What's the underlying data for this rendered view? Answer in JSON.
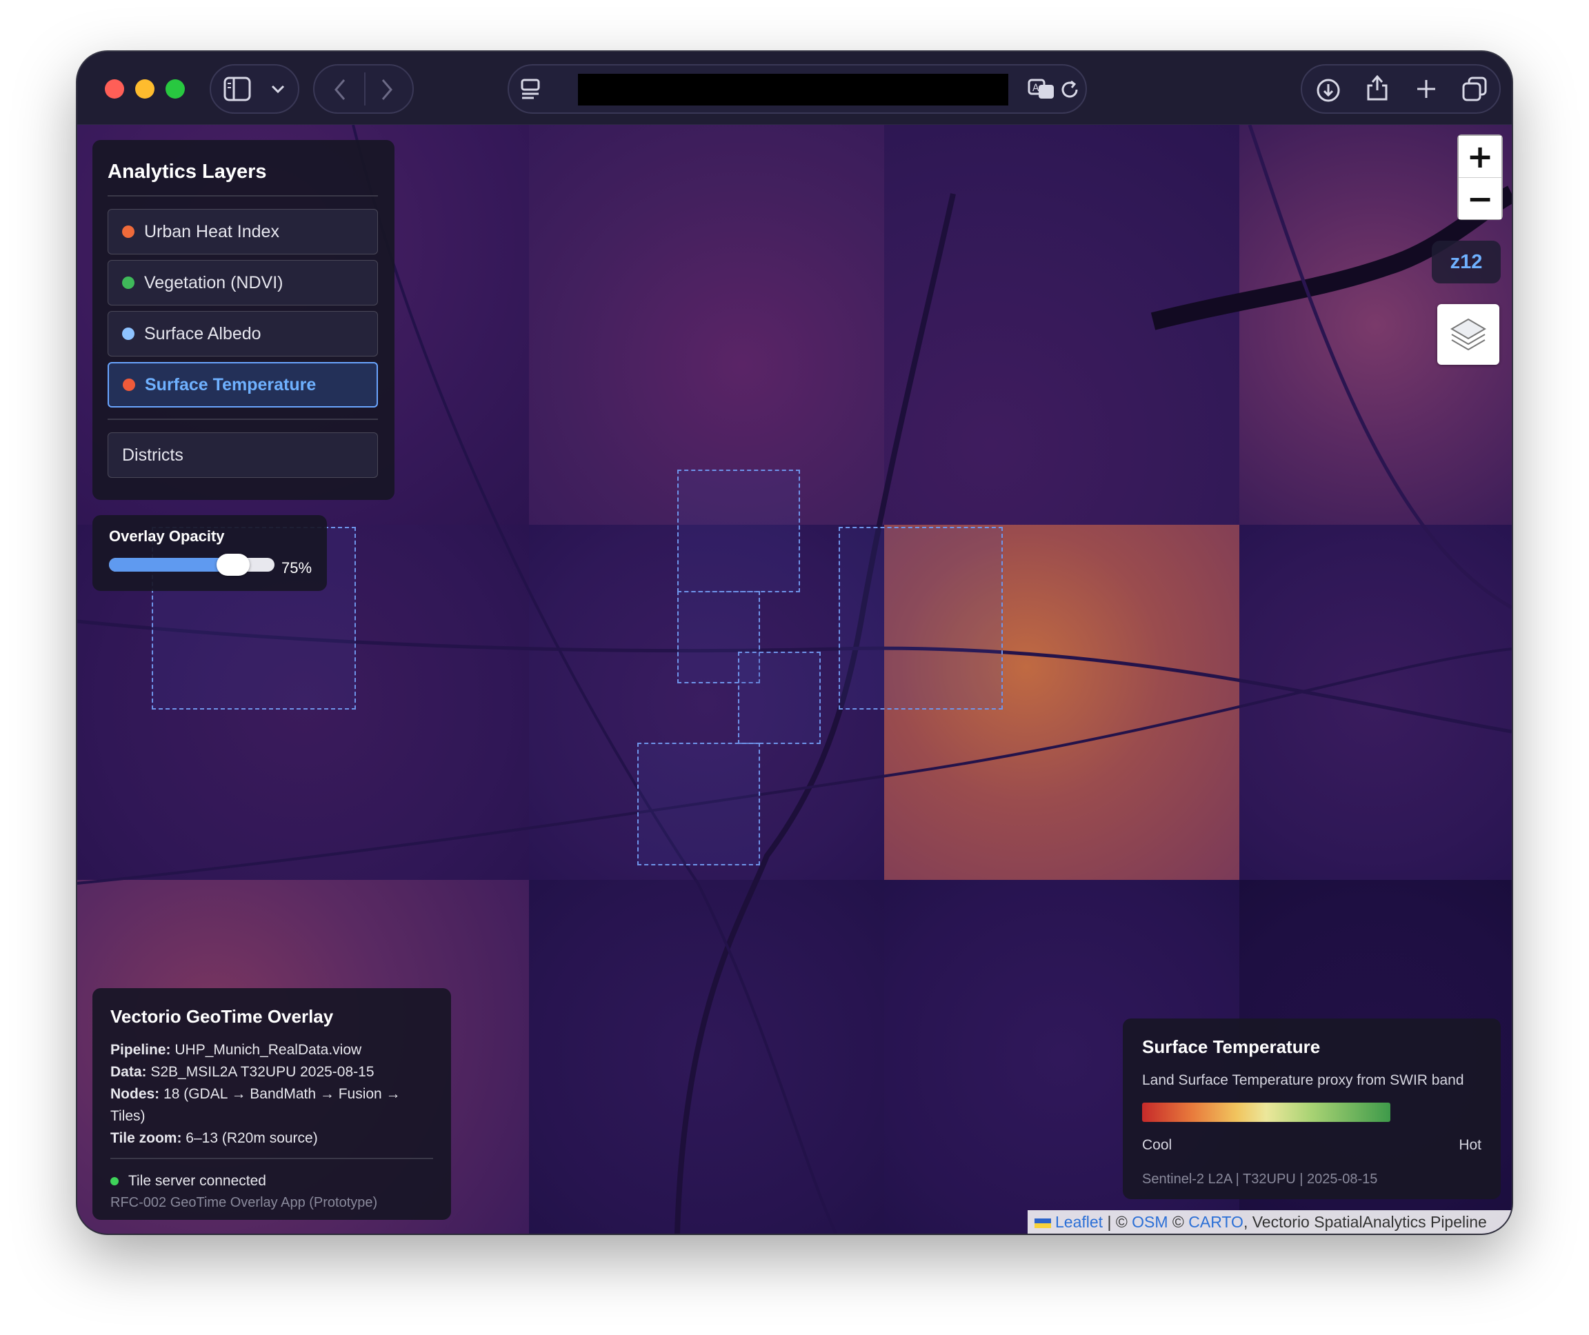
{
  "browser": {
    "address_bar_value": "",
    "icons": [
      "sidebar-icon",
      "chevron-down-icon",
      "back-icon",
      "forward-icon",
      "reader-icon",
      "translate-icon",
      "reload-icon",
      "download-icon",
      "share-icon",
      "new-tab-icon",
      "tabs-icon"
    ]
  },
  "layers_panel": {
    "title": "Analytics Layers",
    "items": [
      {
        "label": "Urban Heat Index",
        "color": "#ef6a3a"
      },
      {
        "label": "Vegetation (NDVI)",
        "color": "#3fb95a"
      },
      {
        "label": "Surface Albedo",
        "color": "#8ec3ff"
      },
      {
        "label": "Surface Temperature",
        "color": "#ef5a3a",
        "active": true
      }
    ],
    "extra_label": "Districts"
  },
  "opacity": {
    "label": "Overlay Opacity",
    "value": 75,
    "value_text": "75%"
  },
  "map_controls": {
    "zoom_in": "+",
    "zoom_out": "−",
    "zoom_level": "z12"
  },
  "info_panel": {
    "title": "Vectorio GeoTime Overlay",
    "rows": [
      {
        "key": "Pipeline:",
        "value": "UHP_Munich_RealData.viow"
      },
      {
        "key": "Data:",
        "value": "S2B_MSIL2A T32UPU 2025-08-15"
      },
      {
        "key": "Nodes:",
        "value": "18 (GDAL → BandMath → Fusion → Tiles)"
      },
      {
        "key": "Tile zoom:",
        "value": "6–13 (R20m source)"
      }
    ],
    "status": "Tile server connected",
    "status_color": "#3fd35a",
    "footer": "RFC-002 GeoTime Overlay App (Prototype)"
  },
  "legend": {
    "title": "Surface Temperature",
    "description": "Land Surface Temperature proxy from SWIR band",
    "low_label": "Cool",
    "high_label": "Hot",
    "source": "Sentinel-2 L2A | T32UPU | 2025-08-15"
  },
  "attribution": {
    "leaflet": "Leaflet",
    "sep1": " | © ",
    "osm": "OSM",
    "sep2": " © ",
    "carto": "CARTO",
    "rest": ", Vectorio SpatialAnalytics Pipeline"
  }
}
